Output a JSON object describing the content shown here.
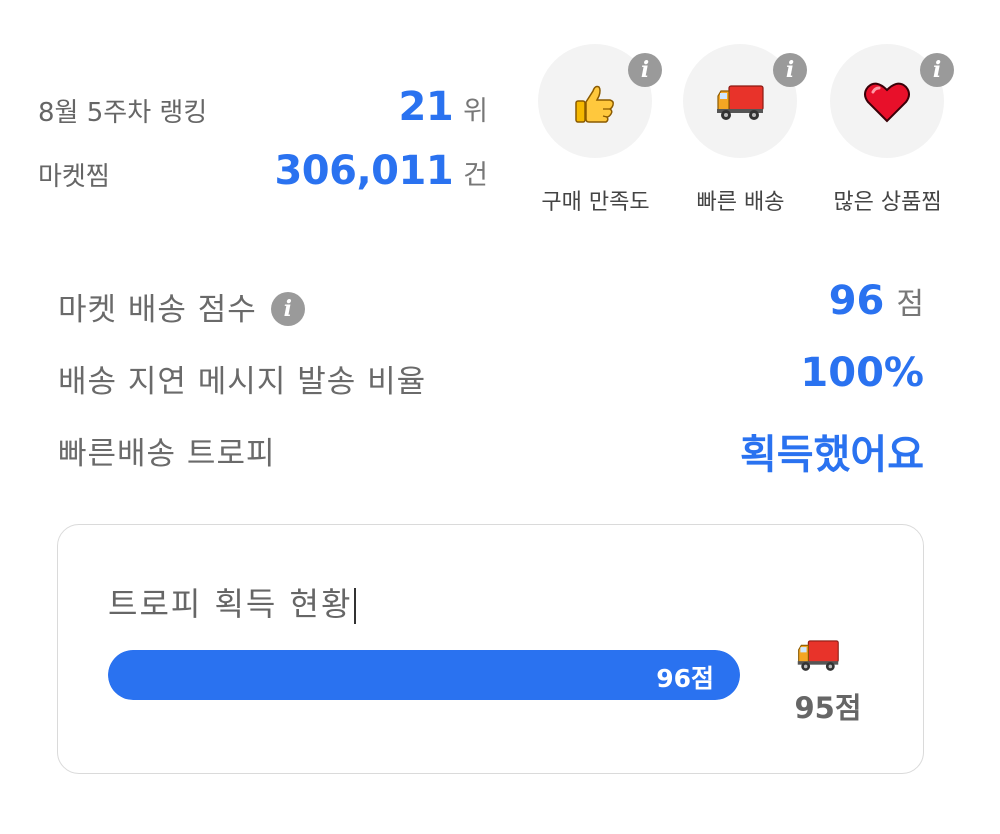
{
  "ranking": {
    "label": "8월 5주차 랭킹",
    "value": "21",
    "unit": "위"
  },
  "market_likes": {
    "label": "마켓찜",
    "value": "306,011",
    "unit": "건"
  },
  "badges": [
    {
      "icon": "thumbs-up-icon",
      "label": "구매 만족도",
      "info": "i"
    },
    {
      "icon": "truck-icon",
      "label": "빠른 배송",
      "info": "i"
    },
    {
      "icon": "heart-icon",
      "label": "많은 상품찜",
      "info": "i"
    }
  ],
  "metrics": {
    "delivery_score": {
      "label": "마켓 배송 점수",
      "info": "i",
      "value": "96",
      "unit": "점"
    },
    "delay_message_ratio": {
      "label": "배송 지연 메시지 발송 비율",
      "value": "100%"
    },
    "fast_delivery_trophy": {
      "label": "빠른배송 트로피",
      "value": "획득했어요"
    }
  },
  "trophy_card": {
    "title": "트로피 획득 현황",
    "progress_label": "96점",
    "progress_percent": 100,
    "goal_icon": "truck-icon",
    "goal_label": "95점"
  },
  "colors": {
    "accent": "#2a72f0",
    "info_badge": "#9a9a9a",
    "badge_bg": "#f3f3f3"
  }
}
